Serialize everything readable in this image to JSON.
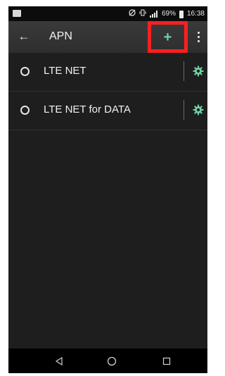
{
  "status_bar": {
    "battery": "69%",
    "time": "16:38",
    "icons": [
      "notification-icon",
      "mute-icon",
      "vibrate-icon",
      "signal-icon",
      "battery-icon"
    ]
  },
  "app_bar": {
    "title": "APN",
    "back_icon": "←",
    "add_icon": "+",
    "accent_color": "#6fd3a5",
    "highlight_color": "#ff1f1f"
  },
  "apns": [
    {
      "label": "LTE NET"
    },
    {
      "label": "LTE NET for DATA"
    }
  ],
  "nav_bar": {
    "buttons": [
      "back-nav",
      "home-nav",
      "recents-nav"
    ]
  }
}
